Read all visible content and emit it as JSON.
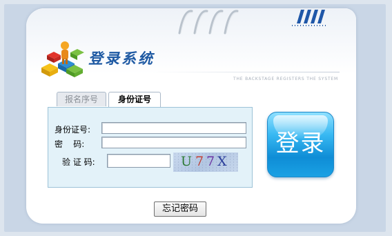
{
  "header": {
    "title": "登录系统",
    "subtitle": "THE BACKSTAGE REGISTERS THE SYSTEM"
  },
  "tabs": [
    {
      "label": "报名序号",
      "active": false
    },
    {
      "label": "身份证号",
      "active": true
    }
  ],
  "form": {
    "id_label": "身份证号:",
    "id_value": "",
    "password_label": "密    码:",
    "password_value": "",
    "captcha_label": "验 证 码:",
    "captcha_value": "",
    "captcha_chars": [
      "U",
      "7",
      "7",
      "X"
    ]
  },
  "buttons": {
    "login_label": "登录",
    "forgot_label": "忘记密码"
  },
  "colors": {
    "accent": "#1f5aa3",
    "login_button": "#1a9ee2",
    "panel_bg": "#e3f2f9",
    "captcha_colors": [
      "#2d7a35",
      "#c23c2e",
      "#6a2fa0",
      "#2b3e9a"
    ]
  },
  "icons": [
    "cubes-person-logo-icon",
    "binder-rings-icon",
    "stripes-decoration-icon"
  ]
}
